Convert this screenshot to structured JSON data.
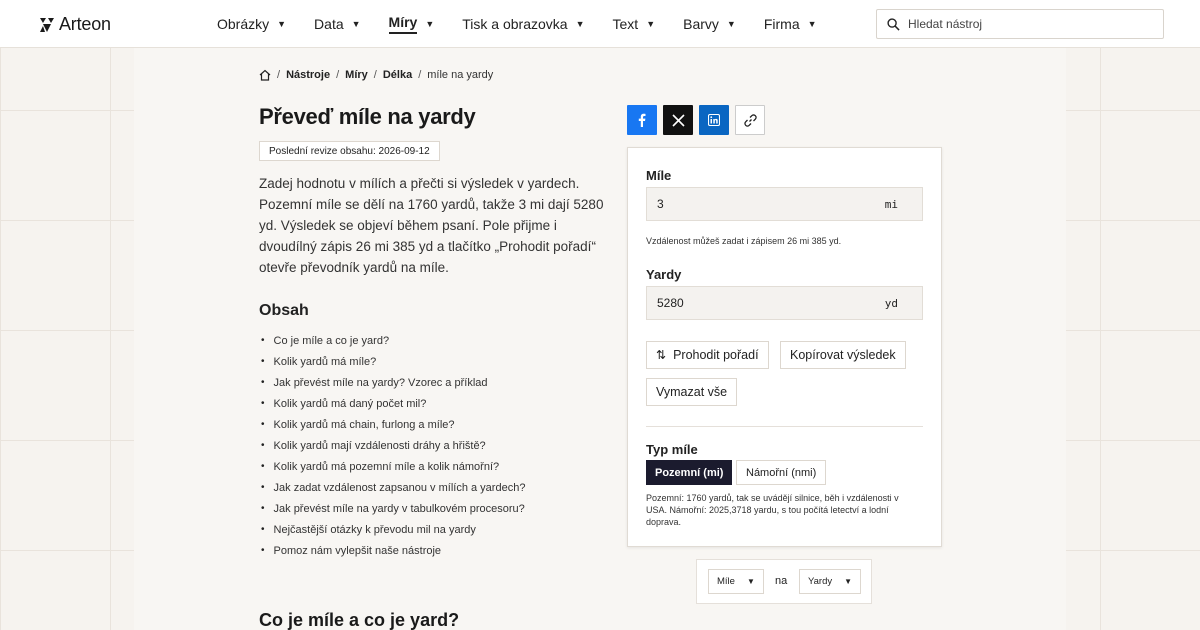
{
  "header": {
    "logo_text": "Arteon",
    "nav": [
      {
        "label": "Obrázky",
        "active": false
      },
      {
        "label": "Data",
        "active": false
      },
      {
        "label": "Míry",
        "active": true
      },
      {
        "label": "Tisk a obrazovka",
        "active": false
      },
      {
        "label": "Text",
        "active": false
      },
      {
        "label": "Barvy",
        "active": false
      },
      {
        "label": "Firma",
        "active": false
      }
    ],
    "search_placeholder": "Hledat nástroj"
  },
  "breadcrumb": {
    "items": [
      "Nástroje",
      "Míry",
      "Délka"
    ],
    "current": "míle na yardy"
  },
  "page": {
    "title": "Převeď míle na yardy",
    "revision": "Poslední revize obsahu: 2026-09-12",
    "intro": "Zadej hodnotu v mílích a přečti si výsledek v yardech. Pozemní míle se dělí na 1760 yardů, takže 3 mi dají 5280 yd. Výsledek se objeví během psaní. Pole přijme i dvoudílný zápis 26 mi 385 yd a tlačítko „Prohodit pořadí“ otevře převodník yardů na míle.",
    "toc_title": "Obsah",
    "toc": [
      "Co je míle a co je yard?",
      "Kolik yardů má míle?",
      "Jak převést míle na yardy? Vzorec a příklad",
      "Kolik yardů má daný počet mil?",
      "Kolik yardů má chain, furlong a míle?",
      "Kolik yardů mají vzdálenosti dráhy a hřiště?",
      "Kolik yardů má pozemní míle a kolik námořní?",
      "Jak zadat vzdálenost zapsanou v mílích a yardech?",
      "Jak převést míle na yardy v tabulkovém procesoru?",
      "Nejčastější otázky k převodu mil na yardy",
      "Pomoz nám vylepšit naše nástroje"
    ],
    "section_title": "Co je míle a co je yard?"
  },
  "converter": {
    "miles_label": "Míle",
    "miles_value": "3",
    "miles_unit": "mi",
    "hint": "Vzdálenost můžeš zadat i zápisem 26 mi 385 yd.",
    "yards_label": "Yardy",
    "yards_value": "5280",
    "yards_unit": "yd",
    "swap_label": "Prohodit pořadí",
    "copy_label": "Kopírovat výsledek",
    "clear_label": "Vymazat vše",
    "type_label": "Typ míle",
    "type_active": "Pozemní (mi)",
    "type_inactive": "Námořní (nmi)",
    "type_note": "Pozemní: 1760 yardů, tak se uvádějí silnice, běh i vzdálenosti v USA. Námořní: 2025,3718 yardu, s tou počítá letectví a lodní doprava."
  },
  "unit_strip": {
    "from": "Míle",
    "connector": "na",
    "to": "Yardy"
  }
}
